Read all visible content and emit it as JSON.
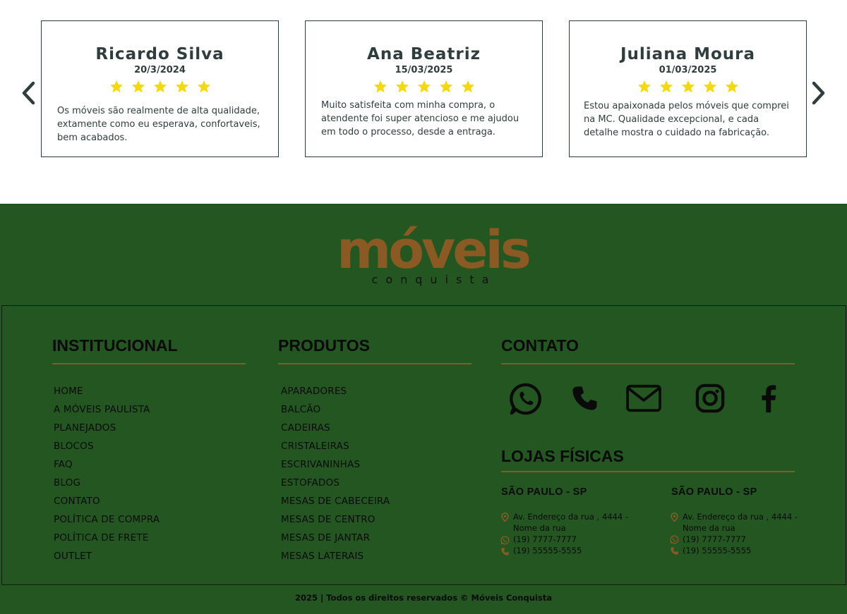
{
  "testimonials": [
    {
      "name": "Ricardo Silva",
      "date": "20/3/2024",
      "rating": 5,
      "text": "Os móveis são realmente de alta qualidade, extamente como eu esperava, confortaveis, bem acabados."
    },
    {
      "name": "Ana Beatriz",
      "date": "15/03/2025",
      "rating": 5,
      "text": "Muito satisfeita com minha compra, o atendente foi super atencioso e me ajudou em todo o processo, desde a entraga."
    },
    {
      "name": "Juliana Moura",
      "date": "01/03/2025",
      "rating": 5,
      "text": "Estou apaixonada pelos móveis que comprei na MC. Qualidade excepcional, e cada detalhe mostra o cuidado na fabricação."
    }
  ],
  "carousel": {
    "prev_icon": "chevron-left-icon",
    "next_icon": "chevron-right-icon"
  },
  "logo": {
    "word": "móveis",
    "sub": "conquista"
  },
  "institucional": {
    "title": "INSTITUCIONAL",
    "links": [
      "HOME",
      "A MÓVEIS PAULISTA",
      "PLANEJADOS",
      "BLOCOS",
      "FAQ",
      "BLOG",
      "CONTATO",
      "POLÍTICA DE COMPRA",
      "POLÍTICA DE FRETE",
      "OUTLET"
    ]
  },
  "produtos": {
    "title": "PRODUTOS",
    "links": [
      "APARADORES",
      "BALCÃO",
      "CADEIRAS",
      "CRISTALEIRAS",
      "ESCRIVANINHAS",
      "ESTOFADOS",
      "MESAS DE CABECEIRA",
      "MESAS DE CENTRO",
      "MESAS DE JANTAR",
      "MESAS LATERAIS"
    ]
  },
  "contato": {
    "title": "CONTATO",
    "icons": [
      "whatsapp-icon",
      "phone-icon",
      "mail-icon",
      "instagram-icon",
      "facebook-icon"
    ]
  },
  "lojas": {
    "title": "LOJAS FÍSICAS",
    "stores": [
      {
        "city": "SÃO PAULO - SP",
        "address_1": "Av. Endereço da rua , 4444 -",
        "address_2": "Nome da rua",
        "whatsapp": "(19) 7777-7777",
        "phone": "(19) 55555-5555"
      },
      {
        "city": "SÃO PAULO - SP",
        "address_1": "Av. Endereço da rua , 4444 -",
        "address_2": "Nome da rua",
        "whatsapp": "(19) 7777-7777",
        "phone": "(19) 55555-5555"
      }
    ]
  },
  "copyright": "2025 | Todos os direitos reservados © Móveis Conquista",
  "colors": {
    "footer_bg": "#235620",
    "accent": "#8a5a26",
    "star": "#f5d90a",
    "text_dark": "#2f3e3d"
  }
}
